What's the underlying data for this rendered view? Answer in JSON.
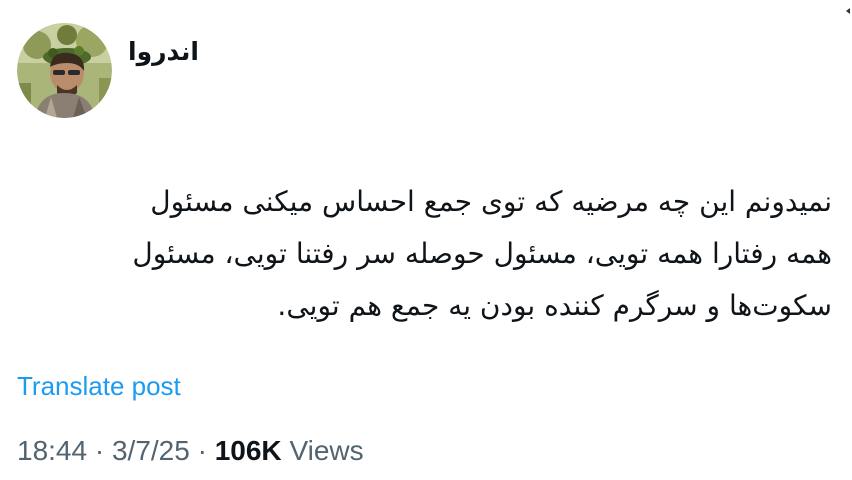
{
  "author": {
    "name": "اندروا"
  },
  "post": {
    "lines": [
      "نمیدونم این چه مرضیه که توی جمع احساس میکنی مسئول",
      "همه رفتارا همه تویی، مسئول حوصله سر رفتنا تویی، مسئول",
      "سکوت‌ها و سرگرم کننده بودن یه جمع هم تویی."
    ]
  },
  "translate_label": "Translate post",
  "meta": {
    "time": "18:44",
    "separator": "·",
    "date": "3/7/25",
    "views_count": "106K",
    "views_label": "Views"
  },
  "colors": {
    "text": "#0f1419",
    "secondary": "#536471",
    "link": "#1d9bf0"
  },
  "icons": {
    "avatar": "avatar-photo",
    "corner": "caret-left-icon"
  }
}
